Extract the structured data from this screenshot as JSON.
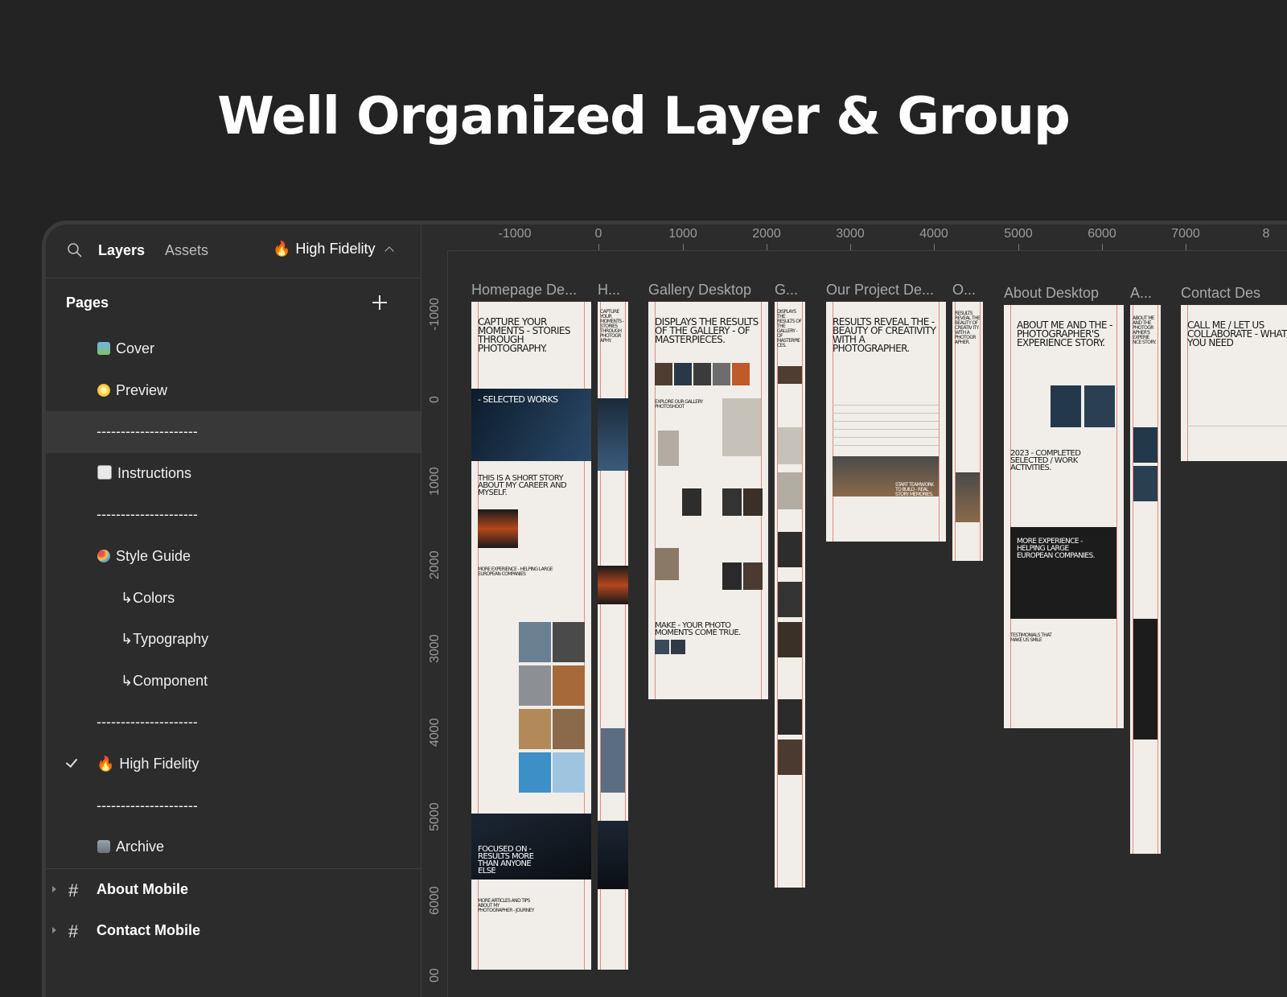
{
  "headline": "Well Organized Layer & Group",
  "sidebar": {
    "tabs": {
      "layers": "Layers",
      "assets": "Assets"
    },
    "current_page": {
      "emoji": "🔥",
      "label": "High Fidelity"
    },
    "pages_title": "Pages",
    "pages": [
      {
        "label": "Cover",
        "icon": "picture-emoji-icon"
      },
      {
        "label": "Preview",
        "icon": "sparkle-emoji-icon"
      },
      {
        "label": "---------------------"
      },
      {
        "label": "Instructions",
        "icon": "document-emoji-icon"
      },
      {
        "label": "---------------------"
      },
      {
        "label": "Style Guide",
        "icon": "palette-emoji-icon"
      },
      {
        "label": "↳Colors"
      },
      {
        "label": "↳Typography"
      },
      {
        "label": "↳Component"
      },
      {
        "label": "---------------------"
      },
      {
        "label": "High Fidelity",
        "icon": "fire-emoji-icon",
        "emoji": "🔥",
        "checked": true
      },
      {
        "label": "---------------------"
      },
      {
        "label": "Archive",
        "icon": "trash-emoji-icon"
      }
    ],
    "frames": [
      {
        "label": "About Mobile"
      },
      {
        "label": "Contact Mobile"
      }
    ]
  },
  "canvas": {
    "ruler_x": [
      "-1000",
      "0",
      "1000",
      "2000",
      "3000",
      "4000",
      "5000",
      "6000",
      "7000",
      "8"
    ],
    "ruler_y": [
      "-1000",
      "0",
      "1000",
      "2000",
      "3000",
      "4000",
      "5000",
      "6000",
      "00"
    ],
    "frames": [
      {
        "label": "Homepage De...",
        "heading": "CAPTURE YOUR MOMENTS - STORIES THROUGH PHOTOGRAPHY."
      },
      {
        "label": "H...",
        "heading": "CAPTURE YOUR MOMENTS - STORIES THROUGH PHOTOGR APHY."
      },
      {
        "label": "Gallery Desktop",
        "heading": "DISPLAYS THE RESULTS OF THE GALLERY - OF MASTERPIECES."
      },
      {
        "label": "G...",
        "heading": "DISPLAYS THE RESULTS OF THE GALLERY - OF MASTERPIE CES."
      },
      {
        "label": "Our Project De...",
        "heading": "RESULTS REVEAL THE - BEAUTY OF CREATIVITY WITH A PHOTOGRAPHER."
      },
      {
        "label": "O...",
        "heading": "RESULTS REVEAL THE BEAUTY OF CREATIV ITY WITH A PHOTOGR APHER."
      },
      {
        "label": "About Desktop",
        "heading": "ABOUT ME AND THE - PHOTOGRAPHER'S EXPERIENCE STORY."
      },
      {
        "label": "A...",
        "heading": "ABOUT ME AND THE PHOTOGR APHER'S EXPERIE NCE STORY."
      },
      {
        "label": "Contact Des",
        "heading": "CALL ME / LET US COLLABORATE - WHAT YOU NEED"
      }
    ],
    "texts": {
      "selected_works": "- SELECTED WORKS",
      "short_story": "THIS IS A SHORT STORY ABOUT MY CAREER AND MYSELF.",
      "more_experience": "MORE EXPERIENCE - HELPING LARGE EUROPEAN COMPANIES",
      "focused": "FOCUSED ON - RESULTS MORE THAN ANYONE ELSE",
      "more_articles": "MORE ARTICLES AND TIPS ABOUT MY PHOTOGRAPHER - JOURNEY",
      "explore": "EXPLORE OUR GALLERY PHOTOSHOOT",
      "make_moments": "MAKE - YOUR PHOTO MOMENTS COME TRUE.",
      "completed": "2023 - COMPLETED SELECTED / WORK ACTIVITIES.",
      "more_experience_2": "MORE EXPERIENCE - HELPING LARGE EUROPEAN COMPANIES.",
      "testimonials": "TESTIMONIALS THAT MAKE US SMILE",
      "teamwork": "START TEAMWORK TO BUILD - REAL STORY MEMORIES."
    }
  }
}
